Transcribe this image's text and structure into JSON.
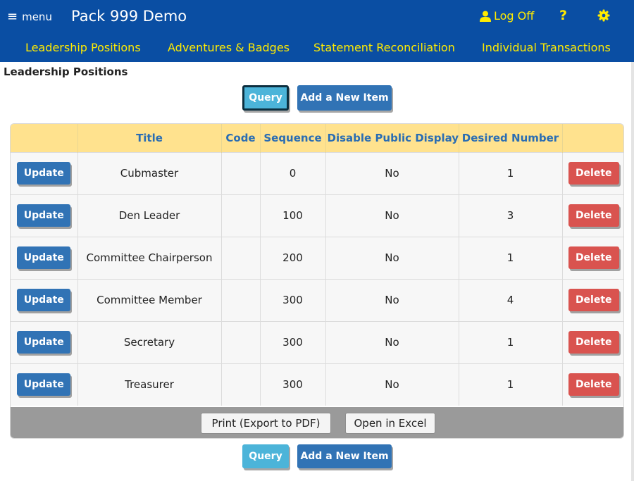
{
  "header": {
    "menu_label": "menu",
    "menu_icon": "hamburger-icon",
    "title": "Pack 999 Demo",
    "logoff_label": "Log Off",
    "help_label": "?",
    "accent_color": "#ffeb00",
    "bar_color": "#0a4ea3"
  },
  "nav": {
    "items": [
      {
        "label": "Leadership Positions"
      },
      {
        "label": "Adventures & Badges"
      },
      {
        "label": "Statement Reconciliation"
      },
      {
        "label": "Individual Transactions"
      }
    ]
  },
  "page": {
    "title": "Leadership Positions"
  },
  "toolbar": {
    "query_label": "Query",
    "add_label": "Add a New Item"
  },
  "table": {
    "columns": [
      "",
      "Title",
      "Code",
      "Sequence",
      "Disable Public Display",
      "Desired Number",
      ""
    ],
    "update_label": "Update",
    "delete_label": "Delete",
    "rows": [
      {
        "title": "Cubmaster",
        "code": "",
        "sequence": "0",
        "disable_public_display": "No",
        "desired_number": "1"
      },
      {
        "title": "Den Leader",
        "code": "",
        "sequence": "100",
        "disable_public_display": "No",
        "desired_number": "3"
      },
      {
        "title": "Committee Chairperson",
        "code": "",
        "sequence": "200",
        "disable_public_display": "No",
        "desired_number": "1"
      },
      {
        "title": "Committee Member",
        "code": "",
        "sequence": "300",
        "disable_public_display": "No",
        "desired_number": "4"
      },
      {
        "title": "Secretary",
        "code": "",
        "sequence": "300",
        "disable_public_display": "No",
        "desired_number": "1"
      },
      {
        "title": "Treasurer",
        "code": "",
        "sequence": "300",
        "disable_public_display": "No",
        "desired_number": "1"
      }
    ]
  },
  "footer": {
    "print_label": "Print (Export to PDF)",
    "excel_label": "Open in Excel"
  }
}
